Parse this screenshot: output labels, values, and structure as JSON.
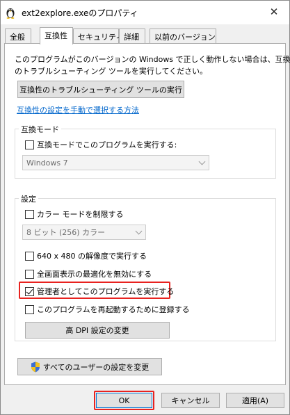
{
  "window": {
    "title": "ext2explore.exeのプロパティ",
    "close_glyph": "✕"
  },
  "tabs": [
    {
      "label": "全般",
      "active": false
    },
    {
      "label": "互換性",
      "active": true
    },
    {
      "label": "セキュリティ",
      "active": false
    },
    {
      "label": "詳細",
      "active": false
    },
    {
      "label": "以前のバージョン",
      "active": false
    }
  ],
  "intro": {
    "line1": "このプログラムがこのバージョンの Windows で正しく動作しない場合は、互換性",
    "line2": "のトラブルシューティング ツールを実行してください。",
    "troubleshoot_button": "互換性のトラブルシューティング ツールの実行",
    "manual_link": "互換性の設定を手動で選択する方法"
  },
  "compat_mode": {
    "group_label": "互換モード",
    "checkbox_label": "互換モードでこのプログラムを実行する:",
    "checked": false,
    "os_select": "Windows 7"
  },
  "settings": {
    "group_label": "設定",
    "color_mode_label": "カラー モードを制限する",
    "color_mode_checked": false,
    "color_select": "8 ビット (256) カラー",
    "res_label": "640 x 480 の解像度で実行する",
    "res_checked": false,
    "fullscreen_label": "全画面表示の最適化を無効にする",
    "fullscreen_checked": false,
    "admin_label": "管理者としてこのプログラムを実行する",
    "admin_checked": true,
    "restart_label": "このプログラムを再起動するために登録する",
    "restart_checked": false,
    "dpi_button": "高 DPI 設定の変更"
  },
  "all_users_button": "すべてのユーザーの設定を変更",
  "footer": {
    "ok": "OK",
    "cancel": "キャンセル",
    "apply": "適用(A)"
  },
  "colors": {
    "highlight": "#e8221f",
    "link": "#0066cc",
    "accent": "#0078d7"
  }
}
